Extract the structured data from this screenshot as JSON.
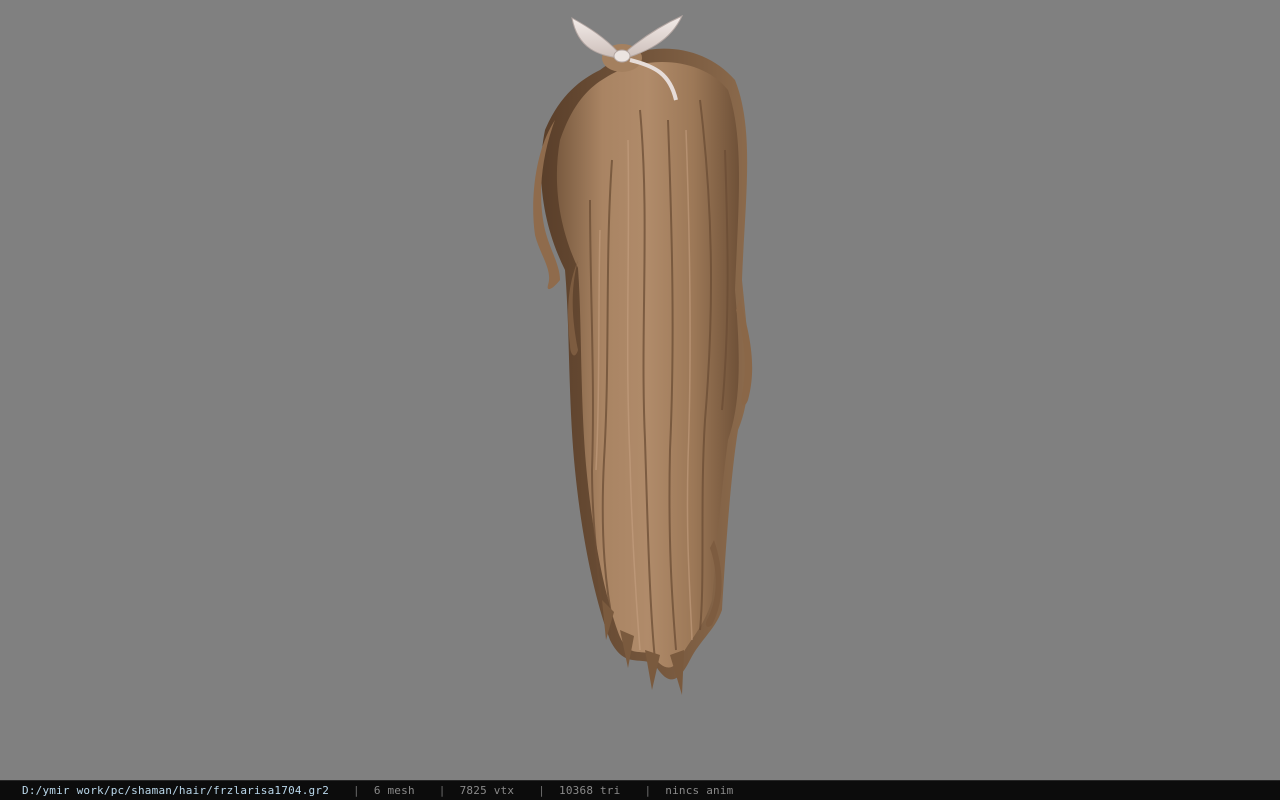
{
  "viewport": {
    "background_color": "#808080",
    "model": {
      "description_icon": "hair-model",
      "hair_color": "#a07d5f",
      "ribbon_color": "#e6dcd8"
    }
  },
  "status_bar": {
    "file_path": "D:/ymir work/pc/shaman/hair/frzlarisa1704.gr2",
    "separator": "|",
    "mesh_count": "6 mesh",
    "vertex_count": "7825 vtx",
    "triangle_count": "10368 tri",
    "anim_status": "nincs anim",
    "path_color": "#b9d7ea",
    "text_color": "#8a8a8a"
  }
}
